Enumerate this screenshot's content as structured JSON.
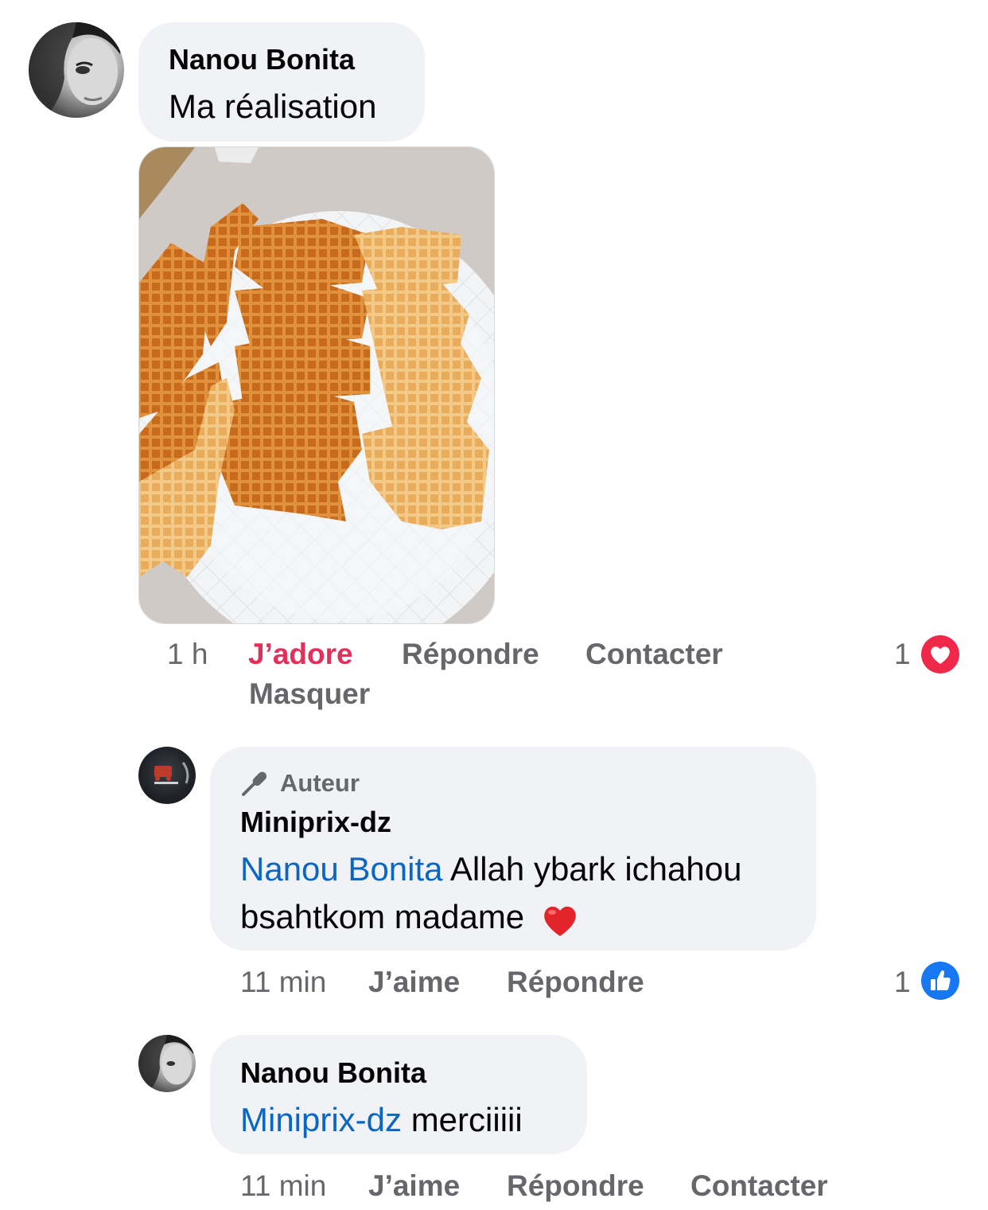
{
  "comments": [
    {
      "author": "Nanou Bonita",
      "text": "Ma réalisation",
      "time": "1 h",
      "actions": [
        "J’adore",
        "Répondre",
        "Contacter",
        "Masquer"
      ],
      "reaction_count": "1",
      "reaction_type": "heart-icon"
    },
    {
      "badge": "Auteur",
      "author": "Miniprix-dz",
      "mention": "Nanou Bonita",
      "text_line1": " Allah ybark ichahou",
      "text_line2": "bsahtkom madame",
      "emoji": "❤️",
      "time": "11 min",
      "actions": [
        "J’aime",
        "Répondre"
      ],
      "reaction_count": "1",
      "reaction_type": "like-icon"
    },
    {
      "author": "Nanou Bonita",
      "mention": "Miniprix-dz",
      "text": " merciiiii",
      "time": "11 min",
      "actions": [
        "J’aime",
        "Répondre",
        "Contacter"
      ]
    }
  ],
  "colors": {
    "bubble": "#f0f2f5",
    "mention": "#0a66c2",
    "love_active": "#e2305a",
    "secondary_text": "#65676b",
    "like_blue": "#1877f2",
    "heart_red": "#f0284a"
  }
}
